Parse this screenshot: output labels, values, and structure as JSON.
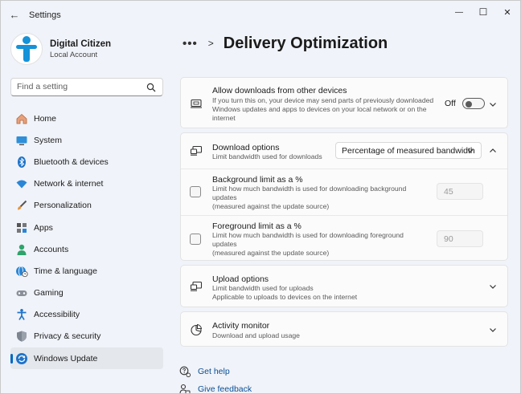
{
  "window": {
    "title": "Settings",
    "back_glyph": "←",
    "controls": {
      "minimize": "—",
      "maximize": "☐",
      "close": "✕"
    }
  },
  "profile": {
    "name": "Digital Citizen",
    "account": "Local Account"
  },
  "search": {
    "placeholder": "Find a setting"
  },
  "sidebar": {
    "items": [
      {
        "label": "Home",
        "icon": "home-icon"
      },
      {
        "label": "System",
        "icon": "system-icon"
      },
      {
        "label": "Bluetooth & devices",
        "icon": "bluetooth-icon"
      },
      {
        "label": "Network & internet",
        "icon": "wifi-icon"
      },
      {
        "label": "Personalization",
        "icon": "brush-icon"
      },
      {
        "label": "Apps",
        "icon": "apps-icon"
      },
      {
        "label": "Accounts",
        "icon": "person-icon"
      },
      {
        "label": "Time & language",
        "icon": "globe-clock-icon"
      },
      {
        "label": "Gaming",
        "icon": "gamepad-icon"
      },
      {
        "label": "Accessibility",
        "icon": "accessibility-icon"
      },
      {
        "label": "Privacy & security",
        "icon": "shield-icon"
      },
      {
        "label": "Windows Update",
        "icon": "update-icon",
        "active": true
      }
    ]
  },
  "breadcrumb": {
    "dots": "•••",
    "separator": ">",
    "title": "Delivery Optimization"
  },
  "settings": {
    "allow_downloads": {
      "title": "Allow downloads from other devices",
      "description_lines": [
        "If you turn this on, your device may send parts of previously downloaded",
        "Windows updates and apps to devices on your local network or on the",
        "internet"
      ],
      "state_label": "Off",
      "enabled": false
    },
    "download_options": {
      "title": "Download options",
      "subtitle": "Limit bandwidth used for downloads",
      "selected_option": "Percentage of measured bandwidth",
      "expanded": true
    },
    "background_limit": {
      "title": "Background limit as a %",
      "description_lines": [
        "Limit how much bandwidth is used for downloading background",
        "updates",
        "(measured against the update source)"
      ],
      "checked": false,
      "value": "45"
    },
    "foreground_limit": {
      "title": "Foreground limit as a %",
      "description_lines": [
        "Limit how much bandwidth is used for downloading foreground",
        "updates",
        "(measured against the update source)"
      ],
      "checked": false,
      "value": "90"
    },
    "upload_options": {
      "title": "Upload options",
      "subtitle_lines": [
        "Limit bandwidth used for uploads",
        "Applicable to uploads to devices on the internet"
      ]
    },
    "activity_monitor": {
      "title": "Activity monitor",
      "subtitle": "Download and upload usage"
    }
  },
  "links": {
    "get_help": "Get help",
    "give_feedback": "Give feedback"
  },
  "colors": {
    "accent": "#0067c0",
    "link": "#0a4f94",
    "window_bg": "#f0f3f9",
    "card_bg": "#fbfbfb"
  }
}
